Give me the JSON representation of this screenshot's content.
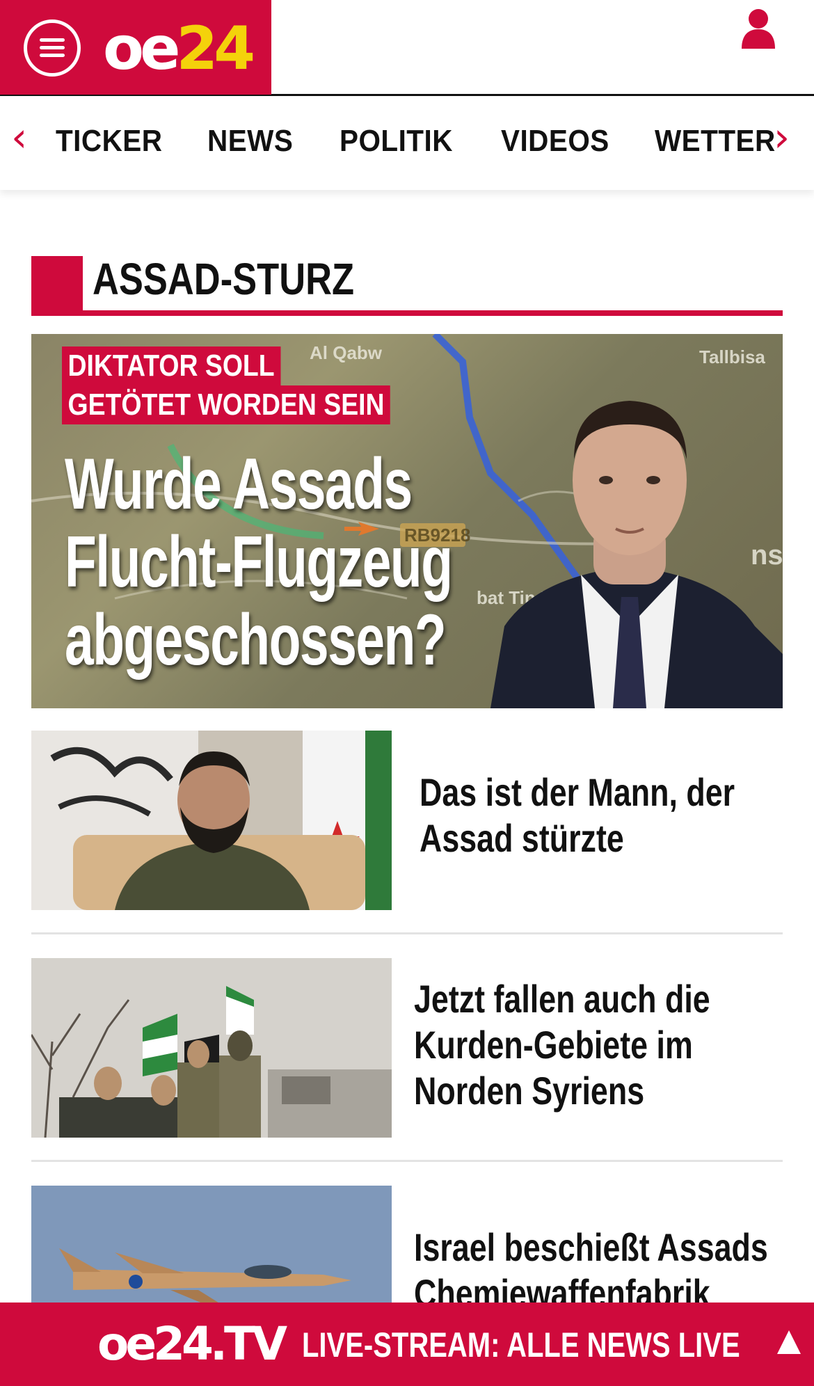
{
  "header": {
    "logo_oe": "oe",
    "logo_num": "24"
  },
  "nav": {
    "items": [
      "TICKER",
      "NEWS",
      "POLITIK",
      "VIDEOS",
      "WETTER"
    ]
  },
  "section": {
    "title": "ASSAD-STURZ"
  },
  "hero": {
    "kicker_line1": "DIKTATOR SOLL",
    "kicker_line2": "GETÖTET WORDEN SEIN",
    "headline": "Wurde Assads\nFlucht-Flugzeug\nabgeschossen?",
    "map_labels": [
      "Al Qabw",
      "Tallbisa",
      "RB9218",
      "bat Tin Nü",
      "ns"
    ]
  },
  "articles": [
    {
      "title": "Das ist der Mann, der\nAssad stürzte"
    },
    {
      "title": "Jetzt fallen auch die\nKurden-Gebiete im\nNorden Syriens"
    },
    {
      "title": "Israel beschießt Assads\nChemiewaffenfabrik"
    }
  ],
  "livebar": {
    "logo": "oe24.TV",
    "text": "LIVE-STREAM:  ALLE NEWS LIVE"
  },
  "colors": {
    "brand_red": "#cf0a3c",
    "logo_yellow": "#f4d20b"
  },
  "icons": {
    "menu": "hamburger-icon",
    "user": "user-icon",
    "nav_prev": "chevron-left-icon",
    "nav_next": "chevron-right-icon",
    "scroll_top": "triangle-up-icon"
  }
}
